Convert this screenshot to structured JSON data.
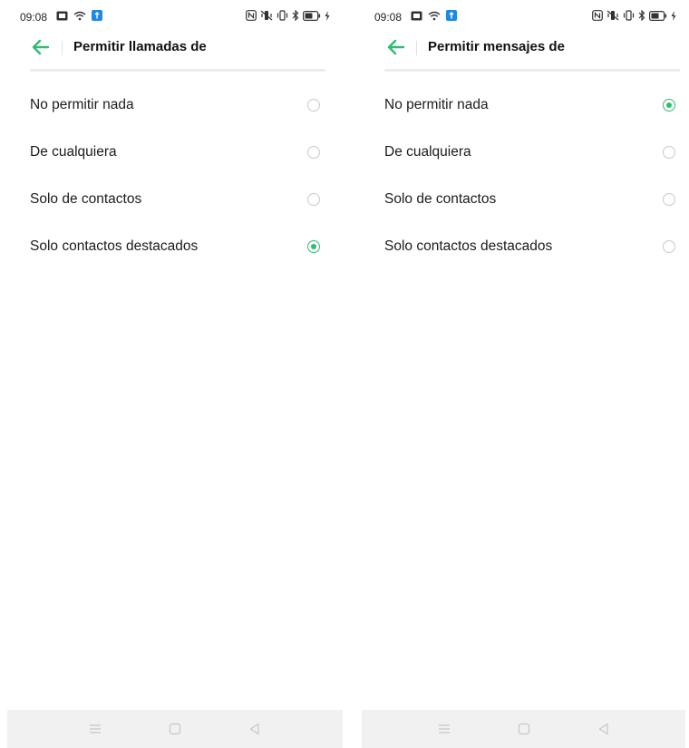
{
  "screens": [
    {
      "status_bar": {
        "time": "09:08"
      },
      "toolbar": {
        "title": "Permitir llamadas de"
      },
      "options": [
        {
          "label": "No permitir nada",
          "selected": false
        },
        {
          "label": "De cualquiera",
          "selected": false
        },
        {
          "label": "Solo de contactos",
          "selected": false
        },
        {
          "label": "Solo contactos destacados",
          "selected": true
        }
      ]
    },
    {
      "status_bar": {
        "time": "09:08"
      },
      "toolbar": {
        "title": "Permitir mensajes de"
      },
      "options": [
        {
          "label": "No permitir nada",
          "selected": true
        },
        {
          "label": "De cualquiera",
          "selected": false
        },
        {
          "label": "Solo de contactos",
          "selected": false
        },
        {
          "label": "Solo contactos destacados",
          "selected": false
        }
      ]
    }
  ],
  "colors": {
    "accent": "#2dbd73",
    "divider": "#ececec",
    "nav_background": "#f1f1f1"
  },
  "icons": {
    "status_left": [
      "notification-image-icon",
      "wifi-icon",
      "app-notification-icon"
    ],
    "status_right": [
      "nfc-icon",
      "vibrate-off-icon",
      "vibrate-icon",
      "bluetooth-icon",
      "battery-icon",
      "charging-icon"
    ],
    "toolbar": "back-arrow-icon",
    "nav": [
      "menu-icon",
      "home-icon",
      "back-icon"
    ]
  }
}
